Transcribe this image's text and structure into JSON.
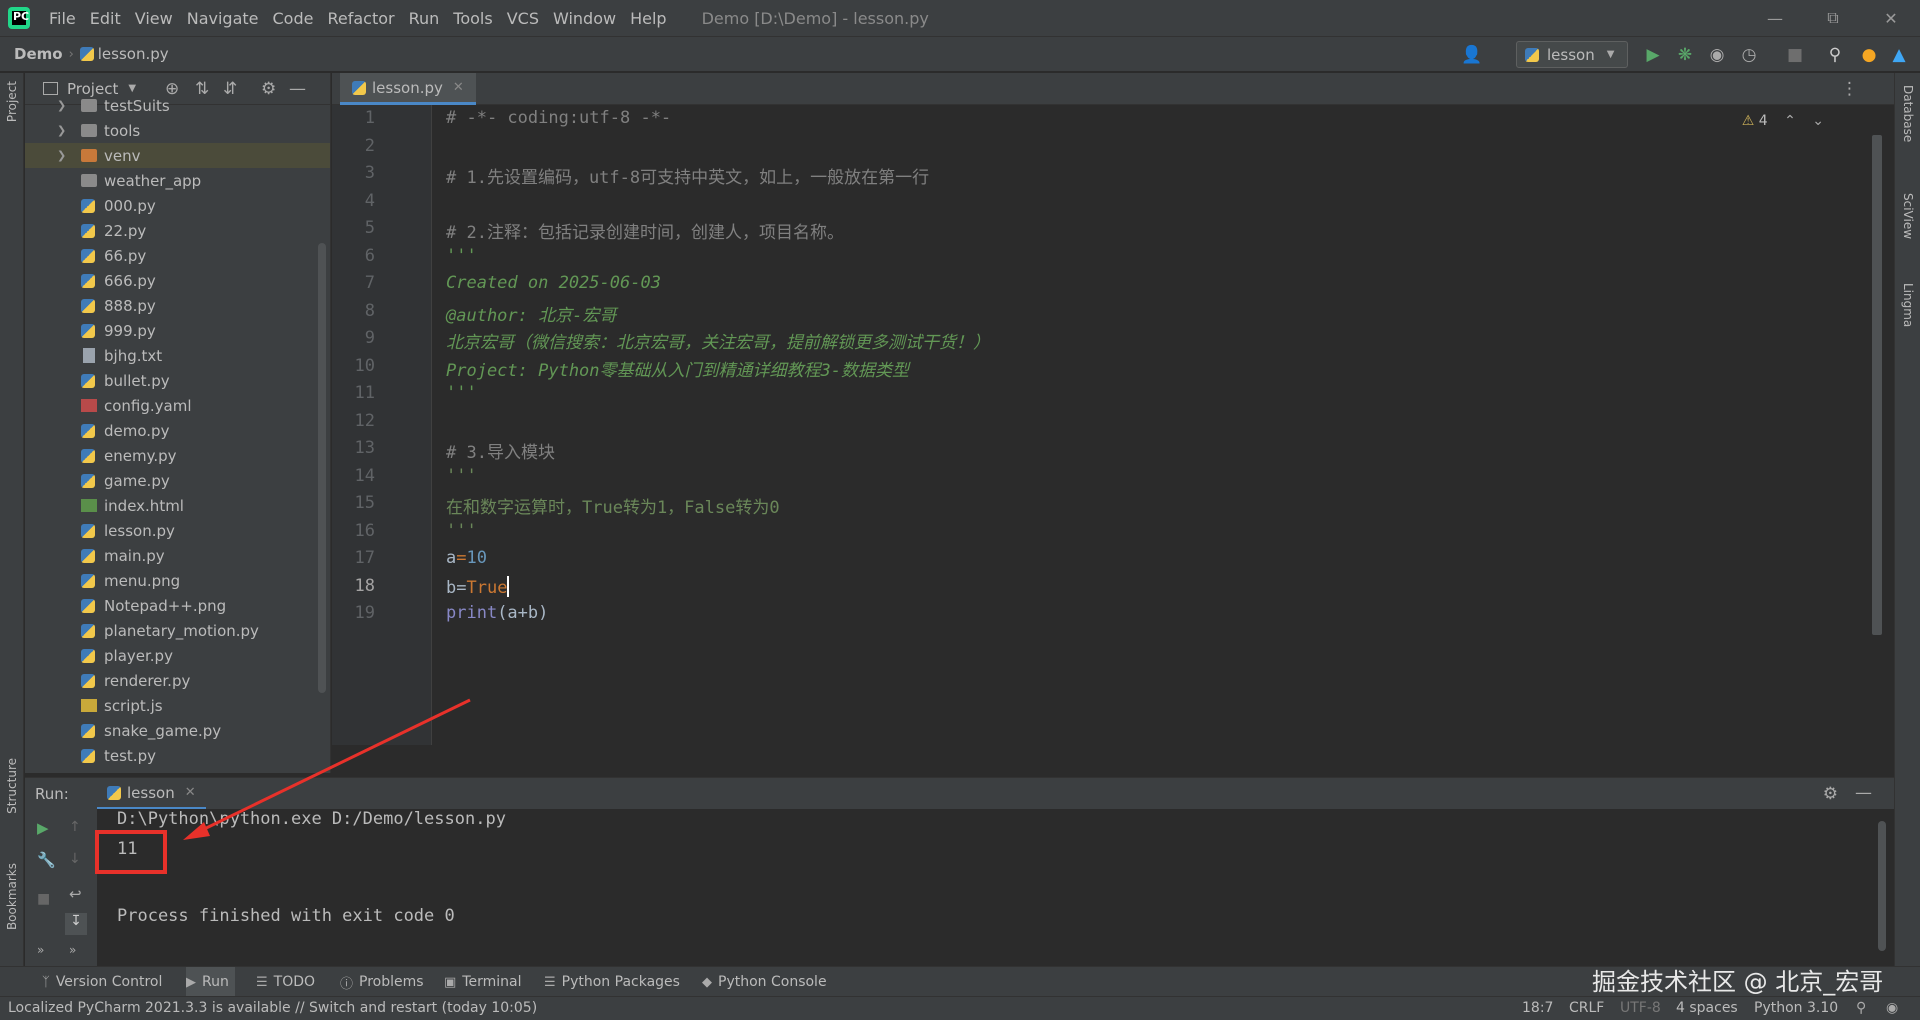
{
  "menu": {
    "logo_letters": "PC",
    "items": [
      "File",
      "Edit",
      "View",
      "Navigate",
      "Code",
      "Refactor",
      "Run",
      "Tools",
      "VCS",
      "Window",
      "Help"
    ],
    "window_title": "Demo [D:\\Demo] - lesson.py"
  },
  "nav": {
    "project": "Demo",
    "file": "lesson.py",
    "run_config": "lesson"
  },
  "project_panel": {
    "title": "Project",
    "items": [
      {
        "label": "testSuits",
        "kind": "folder"
      },
      {
        "label": "tools",
        "kind": "folder"
      },
      {
        "label": "venv",
        "kind": "folder-orange"
      },
      {
        "label": "weather_app",
        "kind": "folder"
      },
      {
        "label": "000.py",
        "kind": "py"
      },
      {
        "label": "22.py",
        "kind": "py"
      },
      {
        "label": "66.py",
        "kind": "py"
      },
      {
        "label": "666.py",
        "kind": "py"
      },
      {
        "label": "888.py",
        "kind": "py"
      },
      {
        "label": "999.py",
        "kind": "py"
      },
      {
        "label": "bjhg.txt",
        "kind": "txt"
      },
      {
        "label": "bullet.py",
        "kind": "py"
      },
      {
        "label": "config.yaml",
        "kind": "yaml"
      },
      {
        "label": "demo.py",
        "kind": "py"
      },
      {
        "label": "enemy.py",
        "kind": "py"
      },
      {
        "label": "game.py",
        "kind": "py"
      },
      {
        "label": "index.html",
        "kind": "html"
      },
      {
        "label": "lesson.py",
        "kind": "py"
      },
      {
        "label": "main.py",
        "kind": "py"
      },
      {
        "label": "menu.png",
        "kind": "img"
      },
      {
        "label": "Notepad++.png",
        "kind": "img"
      },
      {
        "label": "planetary_motion.py",
        "kind": "py"
      },
      {
        "label": "player.py",
        "kind": "py"
      },
      {
        "label": "renderer.py",
        "kind": "py"
      },
      {
        "label": "script.js",
        "kind": "js"
      },
      {
        "label": "snake_game.py",
        "kind": "py"
      },
      {
        "label": "test.py",
        "kind": "py"
      }
    ]
  },
  "editor": {
    "tab": "lesson.py",
    "warnings": "4",
    "lines": [
      {
        "n": "1",
        "segs": [
          [
            "c-comment",
            "# -*- coding:utf-8 -*-"
          ]
        ]
      },
      {
        "n": "2",
        "segs": []
      },
      {
        "n": "3",
        "segs": [
          [
            "c-comment",
            "# 1.先设置编码，utf-8可支持中英文，如上，一般放在第一行"
          ]
        ]
      },
      {
        "n": "4",
        "segs": []
      },
      {
        "n": "5",
        "segs": [
          [
            "c-comment",
            "# 2.注释：包括记录创建时间，创建人，项目名称。"
          ]
        ]
      },
      {
        "n": "6",
        "segs": [
          [
            "c-doc",
            "'''"
          ]
        ]
      },
      {
        "n": "7",
        "segs": [
          [
            "c-doc",
            "Created on 2025-06-03"
          ]
        ]
      },
      {
        "n": "8",
        "segs": [
          [
            "c-doc",
            "@author: 北京-宏哥"
          ]
        ]
      },
      {
        "n": "9",
        "segs": [
          [
            "c-doc",
            "北京宏哥（微信搜索：北京宏哥，关注宏哥，提前解锁更多测试干货！）"
          ]
        ]
      },
      {
        "n": "10",
        "segs": [
          [
            "c-doc",
            "Project: Python零基础从入门到精通详细教程3-数据类型"
          ]
        ]
      },
      {
        "n": "11",
        "segs": [
          [
            "c-doc",
            "'''"
          ]
        ]
      },
      {
        "n": "12",
        "segs": []
      },
      {
        "n": "13",
        "segs": [
          [
            "c-comment",
            "# 3.导入模块"
          ]
        ]
      },
      {
        "n": "14",
        "segs": [
          [
            "c-str",
            "'''"
          ]
        ]
      },
      {
        "n": "15",
        "segs": [
          [
            "c-str",
            "在和数字运算时，True转为1，False转为0"
          ]
        ]
      },
      {
        "n": "16",
        "segs": [
          [
            "c-str",
            "'''"
          ]
        ]
      },
      {
        "n": "17",
        "segs": [
          [
            "",
            "a"
          ],
          [
            "c-kw",
            "="
          ],
          [
            "c-num",
            "10"
          ]
        ]
      },
      {
        "n": "18",
        "segs": [
          [
            "",
            "b="
          ],
          [
            "c-kw",
            "True"
          ]
        ]
      },
      {
        "n": "19",
        "segs": [
          [
            "c-builtin",
            "print"
          ],
          [
            "",
            "(a+b)"
          ]
        ]
      }
    ]
  },
  "run": {
    "label": "Run:",
    "tab": "lesson",
    "output": [
      "D:\\Python\\python.exe D:/Demo/lesson.py",
      "11",
      "",
      "Process finished with exit code 0"
    ]
  },
  "toolwindows": [
    "Version Control",
    "Run",
    "TODO",
    "Problems",
    "Terminal",
    "Python Packages",
    "Python Console"
  ],
  "left_stripe": {
    "project": "Project",
    "structure": "Structure",
    "bookmarks": "Bookmarks"
  },
  "right_stripe": {
    "database": "Database",
    "sciview": "SciView",
    "lingma": "Lingma"
  },
  "status": {
    "message": "Localized PyCharm 2021.3.3 is available // Switch and restart (today 10:05)",
    "position": "18:7",
    "line_sep": "CRLF",
    "encoding": "UTF-8",
    "indent": "4 spaces",
    "interpreter": "Python 3.10"
  },
  "watermark": "掘金技术社区 @ 北京_宏哥",
  "colors": {
    "accent": "#4a88c7",
    "annotation": "#e8312a"
  }
}
